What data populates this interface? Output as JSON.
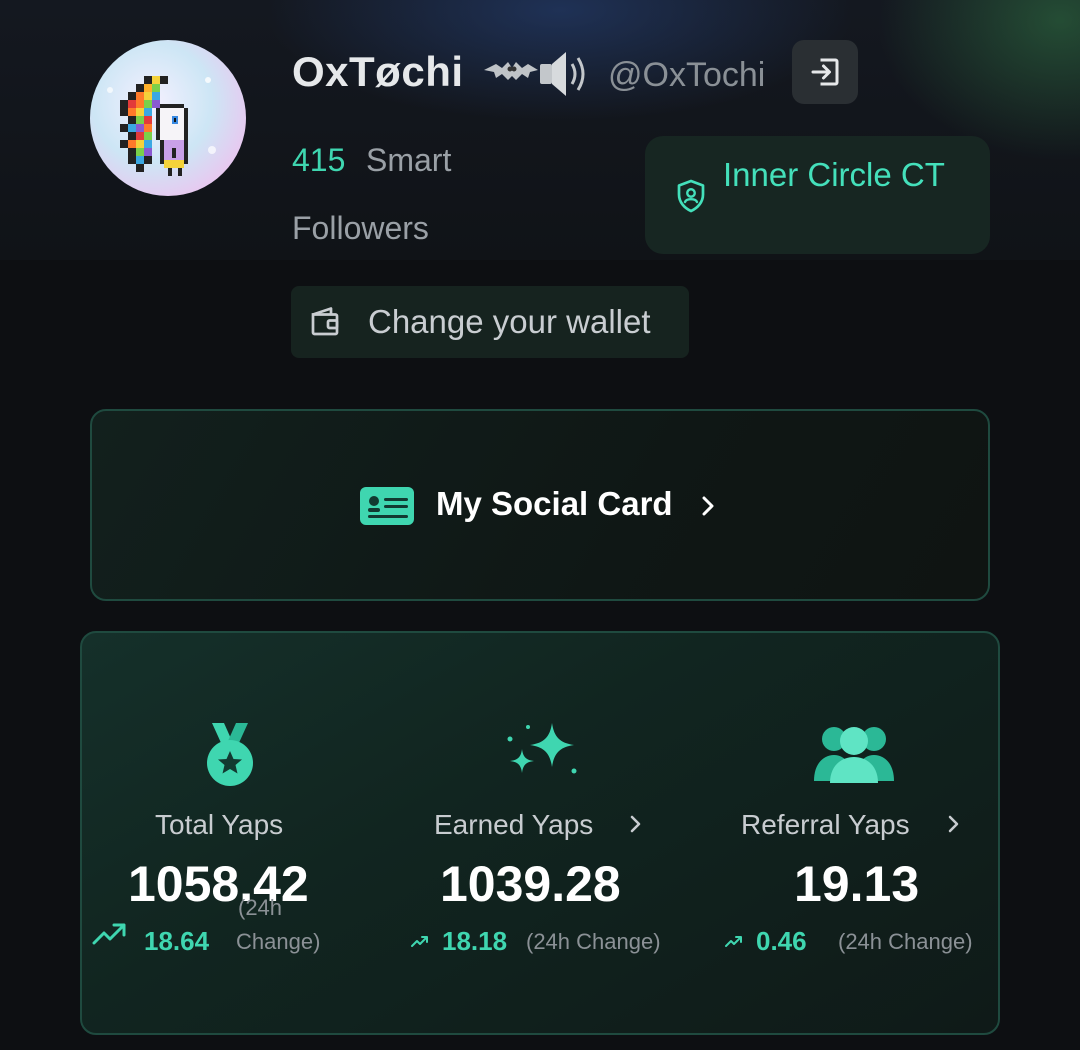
{
  "profile": {
    "name": "OxTøchi",
    "handle": "@OxTochi",
    "smart_followers_count": "415",
    "smart_label": "Smart",
    "followers_label": "Followers",
    "badge_label": "Inner Circle CT",
    "wallet_button_label": "Change your wallet",
    "icons": [
      "bat-emoji",
      "speaker-emoji",
      "logout-icon",
      "shield-icon",
      "wallet-icon"
    ]
  },
  "social_card": {
    "label": "My Social Card",
    "icon": "id-card-icon"
  },
  "stats": {
    "total": {
      "title": "Total Yaps",
      "value": "1058.42",
      "change": "18.64",
      "note_line1": "(24h",
      "note_line2": "Change)",
      "icon": "medal-icon"
    },
    "earned": {
      "title": "Earned Yaps",
      "value": "1039.28",
      "change": "18.18",
      "note": "(24h Change)",
      "icon": "sparkles-icon"
    },
    "referral": {
      "title": "Referral Yaps",
      "value": "19.13",
      "change": "0.46",
      "note": "(24h Change)",
      "icon": "users-icon"
    }
  },
  "colors": {
    "accent": "#3fd6b0",
    "background": "#0d0f12",
    "card_border": "#1f4a3f"
  }
}
